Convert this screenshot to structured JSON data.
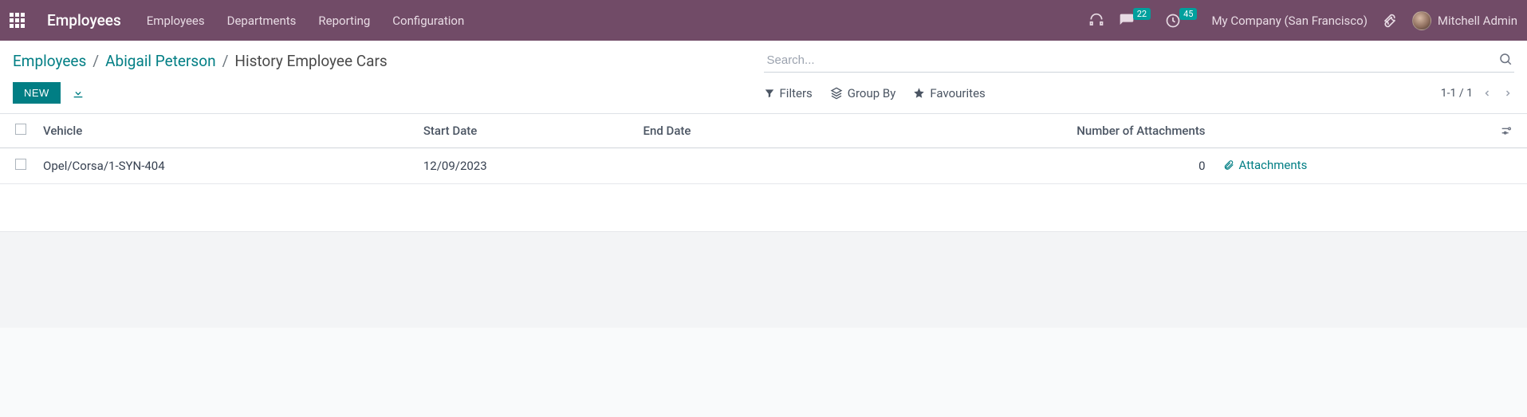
{
  "navbar": {
    "app_name": "Employees",
    "menu": [
      "Employees",
      "Departments",
      "Reporting",
      "Configuration"
    ],
    "messages_badge": "22",
    "activities_badge": "45",
    "company": "My Company (San Francisco)",
    "user": "Mitchell Admin"
  },
  "breadcrumb": {
    "root": "Employees",
    "parent": "Abigail Peterson",
    "current": "History Employee Cars"
  },
  "search": {
    "placeholder": "Search..."
  },
  "buttons": {
    "new": "NEW"
  },
  "filters": {
    "filters": "Filters",
    "groupby": "Group By",
    "favourites": "Favourites"
  },
  "pager": {
    "range": "1-1 / 1"
  },
  "table": {
    "headers": {
      "vehicle": "Vehicle",
      "start": "Start Date",
      "end": "End Date",
      "attachments_count": "Number of Attachments"
    },
    "rows": [
      {
        "vehicle": "Opel/Corsa/1-SYN-404",
        "start": "12/09/2023",
        "end": "",
        "attachments_count": "0",
        "attach_label": "Attachments"
      }
    ]
  }
}
